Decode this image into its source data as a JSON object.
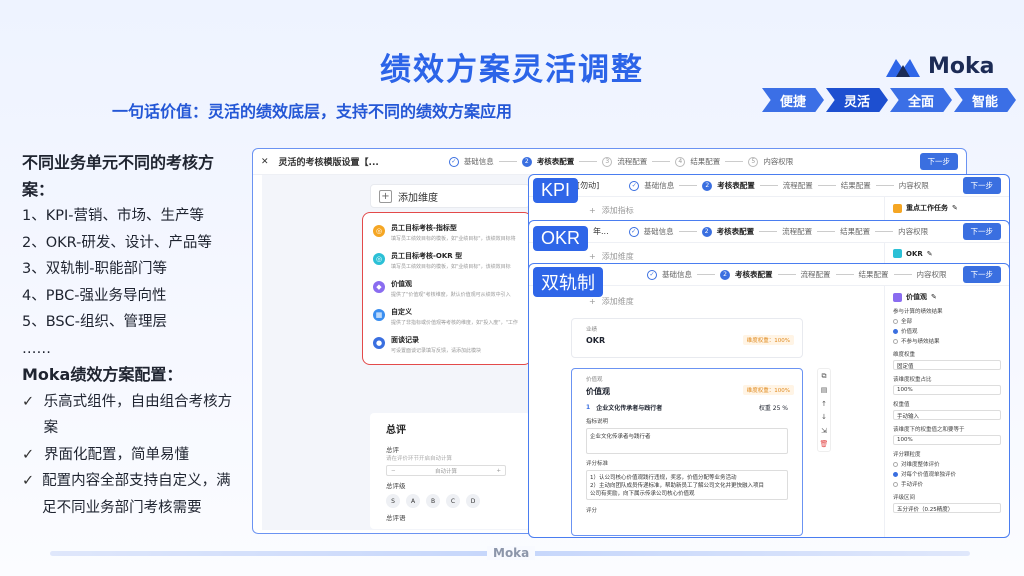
{
  "title": "绩效方案灵活调整",
  "subtitle": "一句话价值：灵活的绩效底层，支持不同的绩效方案应用",
  "logo": "Moka",
  "steps": [
    "便捷",
    "灵活",
    "全面",
    "智能"
  ],
  "left": {
    "heading": "不同业务单元不同的考核方案：",
    "items": [
      "1、KPI-营销、市场、生产等",
      "2、OKR-研发、设计、产品等",
      "3、双轨制-职能部门等",
      "4、PBC-强业务导向性",
      "5、BSC-组织、管理层"
    ],
    "ellipsis": "……",
    "config_heading": "Moka绩效方案配置：",
    "checks": [
      "乐高式组件，自由组合考核方案",
      "界面化配置，简单易懂",
      "配置内容全部支持自定义，满足不同业务部门考核需要"
    ]
  },
  "main_window": {
    "title": "灵活的考核模版设置【...",
    "progress": [
      "基础信息",
      "考核表配置",
      "流程配置",
      "结果配置",
      "内容权限"
    ],
    "next": "下一步",
    "add_dimension": "添加维度",
    "options": [
      {
        "t": "员工目标考核-指标型",
        "d": "填写员工绩效目标的模板，如\"业绩目标\"，该绩效目标将",
        "color": "#f5a623"
      },
      {
        "t": "员工目标考核-OKR 型",
        "d": "填写员工绩效目标的模板，如\"业绩目标\"，该绩效目标",
        "color": "#2bc0d6"
      },
      {
        "t": "价值观",
        "d": "提供了\"价值观\"考核维度，默认价值观可从绩效中引入",
        "color": "#8a6cf0"
      },
      {
        "t": "自定义",
        "d": "提供了非指标或价值观等考核的维度，如\"投入度\"，\"工作",
        "color": "#3a8ef0"
      },
      {
        "t": "面谈记录",
        "d": "可设置面谈记录填写反馈，请添加此模块",
        "color": "#3a6fe0"
      }
    ],
    "total": {
      "title": "总评",
      "label1": "总评",
      "hint": "请在评价环节开启自动计算",
      "calc": "自动计算",
      "label2": "总评级",
      "grades": [
        "S",
        "A",
        "B",
        "C",
        "D"
      ],
      "label3": "总评语"
    }
  },
  "kpi_window": {
    "tag": "KPI",
    "title": "[勿动]",
    "add": "添加指标",
    "side": "重点工作任务"
  },
  "okr_window": {
    "tag": "OKR",
    "title": "年...",
    "add": "添加维度",
    "side": "OKR"
  },
  "dual_window": {
    "tag": "双轨制",
    "add": "添加维度",
    "okr_card": {
      "label": "业绩",
      "name": "OKR",
      "weight": "维度权重：100%"
    },
    "value_card": {
      "label": "价值观",
      "name": "价值观",
      "weight": "维度权重：100%",
      "item": "企业文化传承者与践行者",
      "item_weight": "权重 25 %",
      "desc_label": "指标说明",
      "desc": "企业文化传承者与践行者",
      "std_label": "评分标准",
      "std1": "1）认公司核心价值观践行违规，奖惩，价值分配等业务活动",
      "std2": "2）主动向团队成员传递标准，帮助新员工了解公司文化并更快融入项目",
      "std3": "公司有奖励，向下属示传承公司核心价值观",
      "score": "评分"
    },
    "side": {
      "title": "价值观",
      "f1": "参与计算的绩效结果",
      "o1": "全部",
      "o2": "价值观",
      "o3": "不参与绩效结果",
      "f2": "维度权重",
      "v2": "固定值",
      "f3": "该维度权重占比",
      "v3": "100%",
      "f4": "权重值",
      "v4": "手动输入",
      "f5": "该维度下的权重值之和要等于",
      "v5": "100%",
      "f6": "评分颗粒度",
      "o6a": "对维度整体评价",
      "o6b": "对每个价值观单独评价",
      "o6c": "手动评价",
      "f7": "评级区间",
      "v7": "五分评价（0.25精度）"
    }
  },
  "bottom_logo": "Moka"
}
